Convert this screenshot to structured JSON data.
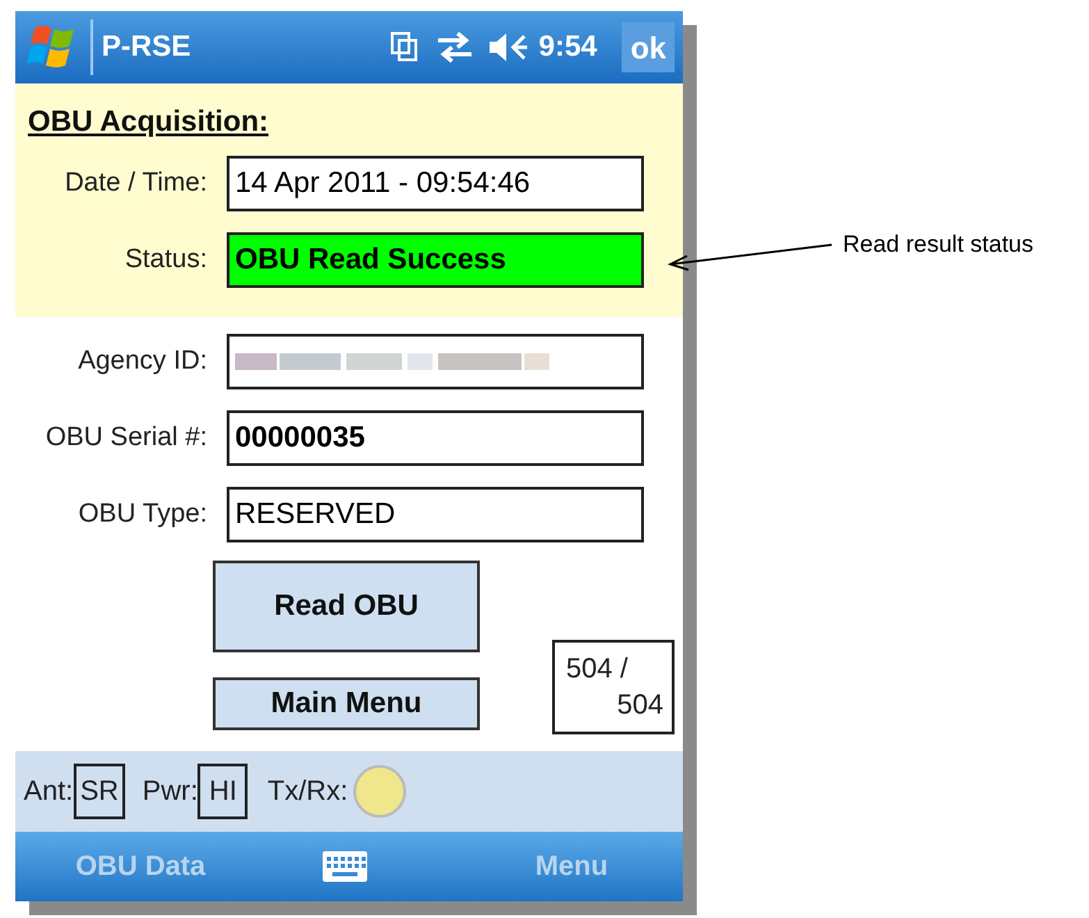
{
  "title_bar": {
    "title": "P-RSE",
    "time": "9:54",
    "ok_button": "ok"
  },
  "heading": "OBU Acquisition:",
  "acquisition_fields": [
    {
      "label": "Date / Time:",
      "value": "14 Apr 2011 - 09:54:46",
      "kind": "plain"
    },
    {
      "label": "Status:",
      "value": "OBU Read Success",
      "kind": "status",
      "color": "#00ff00"
    }
  ],
  "obu_fields": [
    {
      "label": "Agency ID:",
      "kind": "blurred"
    },
    {
      "label": "OBU Serial #:",
      "value": "00000035",
      "kind": "bold"
    },
    {
      "label": "OBU Type:",
      "value": "RESERVED",
      "kind": "plain"
    }
  ],
  "buttons": [
    "Read OBU",
    "Main Menu"
  ],
  "counter": [
    "504 /",
    "504"
  ],
  "status_strip": {
    "antenna_label": "Ant:",
    "antenna": "SR",
    "power_label": "Pwr:",
    "power": "HI",
    "txrx_label": "Tx/Rx:",
    "txrx_indicator": {
      "color": "#f0e68c"
    }
  },
  "softkeys": {
    "left": "OBU Data",
    "right": "Menu"
  },
  "annotation": "Read result status"
}
